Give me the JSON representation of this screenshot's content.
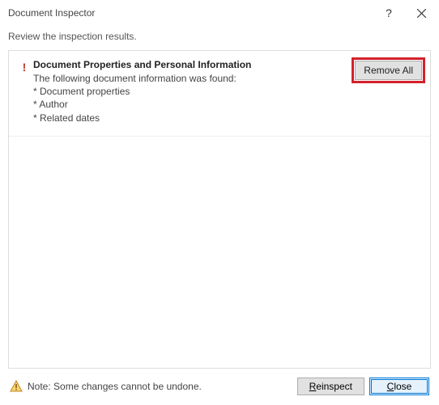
{
  "title": "Document Inspector",
  "subheading": "Review the inspection results.",
  "result": {
    "heading": "Document Properties and Personal Information",
    "intro": "The following document information was found:",
    "items": [
      "* Document properties",
      "* Author",
      "* Related dates"
    ],
    "remove_label": "Remove All"
  },
  "footer": {
    "note": "Note: Some changes cannot be undone.",
    "reinspect_label": "Reinspect",
    "close_label_pre": "",
    "close_label_u": "C",
    "close_label_post": "lose"
  }
}
